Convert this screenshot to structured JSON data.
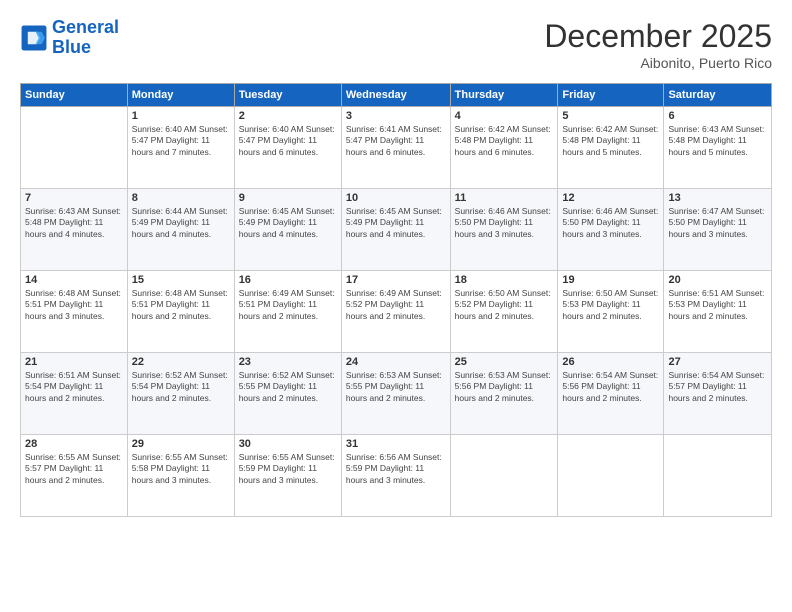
{
  "header": {
    "logo_line1": "General",
    "logo_line2": "Blue",
    "month_title": "December 2025",
    "location": "Aibonito, Puerto Rico"
  },
  "weekdays": [
    "Sunday",
    "Monday",
    "Tuesday",
    "Wednesday",
    "Thursday",
    "Friday",
    "Saturday"
  ],
  "weeks": [
    [
      {
        "day": "",
        "info": ""
      },
      {
        "day": "1",
        "info": "Sunrise: 6:40 AM\nSunset: 5:47 PM\nDaylight: 11 hours\nand 7 minutes."
      },
      {
        "day": "2",
        "info": "Sunrise: 6:40 AM\nSunset: 5:47 PM\nDaylight: 11 hours\nand 6 minutes."
      },
      {
        "day": "3",
        "info": "Sunrise: 6:41 AM\nSunset: 5:47 PM\nDaylight: 11 hours\nand 6 minutes."
      },
      {
        "day": "4",
        "info": "Sunrise: 6:42 AM\nSunset: 5:48 PM\nDaylight: 11 hours\nand 6 minutes."
      },
      {
        "day": "5",
        "info": "Sunrise: 6:42 AM\nSunset: 5:48 PM\nDaylight: 11 hours\nand 5 minutes."
      },
      {
        "day": "6",
        "info": "Sunrise: 6:43 AM\nSunset: 5:48 PM\nDaylight: 11 hours\nand 5 minutes."
      }
    ],
    [
      {
        "day": "7",
        "info": "Sunrise: 6:43 AM\nSunset: 5:48 PM\nDaylight: 11 hours\nand 4 minutes."
      },
      {
        "day": "8",
        "info": "Sunrise: 6:44 AM\nSunset: 5:49 PM\nDaylight: 11 hours\nand 4 minutes."
      },
      {
        "day": "9",
        "info": "Sunrise: 6:45 AM\nSunset: 5:49 PM\nDaylight: 11 hours\nand 4 minutes."
      },
      {
        "day": "10",
        "info": "Sunrise: 6:45 AM\nSunset: 5:49 PM\nDaylight: 11 hours\nand 4 minutes."
      },
      {
        "day": "11",
        "info": "Sunrise: 6:46 AM\nSunset: 5:50 PM\nDaylight: 11 hours\nand 3 minutes."
      },
      {
        "day": "12",
        "info": "Sunrise: 6:46 AM\nSunset: 5:50 PM\nDaylight: 11 hours\nand 3 minutes."
      },
      {
        "day": "13",
        "info": "Sunrise: 6:47 AM\nSunset: 5:50 PM\nDaylight: 11 hours\nand 3 minutes."
      }
    ],
    [
      {
        "day": "14",
        "info": "Sunrise: 6:48 AM\nSunset: 5:51 PM\nDaylight: 11 hours\nand 3 minutes."
      },
      {
        "day": "15",
        "info": "Sunrise: 6:48 AM\nSunset: 5:51 PM\nDaylight: 11 hours\nand 2 minutes."
      },
      {
        "day": "16",
        "info": "Sunrise: 6:49 AM\nSunset: 5:51 PM\nDaylight: 11 hours\nand 2 minutes."
      },
      {
        "day": "17",
        "info": "Sunrise: 6:49 AM\nSunset: 5:52 PM\nDaylight: 11 hours\nand 2 minutes."
      },
      {
        "day": "18",
        "info": "Sunrise: 6:50 AM\nSunset: 5:52 PM\nDaylight: 11 hours\nand 2 minutes."
      },
      {
        "day": "19",
        "info": "Sunrise: 6:50 AM\nSunset: 5:53 PM\nDaylight: 11 hours\nand 2 minutes."
      },
      {
        "day": "20",
        "info": "Sunrise: 6:51 AM\nSunset: 5:53 PM\nDaylight: 11 hours\nand 2 minutes."
      }
    ],
    [
      {
        "day": "21",
        "info": "Sunrise: 6:51 AM\nSunset: 5:54 PM\nDaylight: 11 hours\nand 2 minutes."
      },
      {
        "day": "22",
        "info": "Sunrise: 6:52 AM\nSunset: 5:54 PM\nDaylight: 11 hours\nand 2 minutes."
      },
      {
        "day": "23",
        "info": "Sunrise: 6:52 AM\nSunset: 5:55 PM\nDaylight: 11 hours\nand 2 minutes."
      },
      {
        "day": "24",
        "info": "Sunrise: 6:53 AM\nSunset: 5:55 PM\nDaylight: 11 hours\nand 2 minutes."
      },
      {
        "day": "25",
        "info": "Sunrise: 6:53 AM\nSunset: 5:56 PM\nDaylight: 11 hours\nand 2 minutes."
      },
      {
        "day": "26",
        "info": "Sunrise: 6:54 AM\nSunset: 5:56 PM\nDaylight: 11 hours\nand 2 minutes."
      },
      {
        "day": "27",
        "info": "Sunrise: 6:54 AM\nSunset: 5:57 PM\nDaylight: 11 hours\nand 2 minutes."
      }
    ],
    [
      {
        "day": "28",
        "info": "Sunrise: 6:55 AM\nSunset: 5:57 PM\nDaylight: 11 hours\nand 2 minutes."
      },
      {
        "day": "29",
        "info": "Sunrise: 6:55 AM\nSunset: 5:58 PM\nDaylight: 11 hours\nand 3 minutes."
      },
      {
        "day": "30",
        "info": "Sunrise: 6:55 AM\nSunset: 5:59 PM\nDaylight: 11 hours\nand 3 minutes."
      },
      {
        "day": "31",
        "info": "Sunrise: 6:56 AM\nSunset: 5:59 PM\nDaylight: 11 hours\nand 3 minutes."
      },
      {
        "day": "",
        "info": ""
      },
      {
        "day": "",
        "info": ""
      },
      {
        "day": "",
        "info": ""
      }
    ]
  ]
}
